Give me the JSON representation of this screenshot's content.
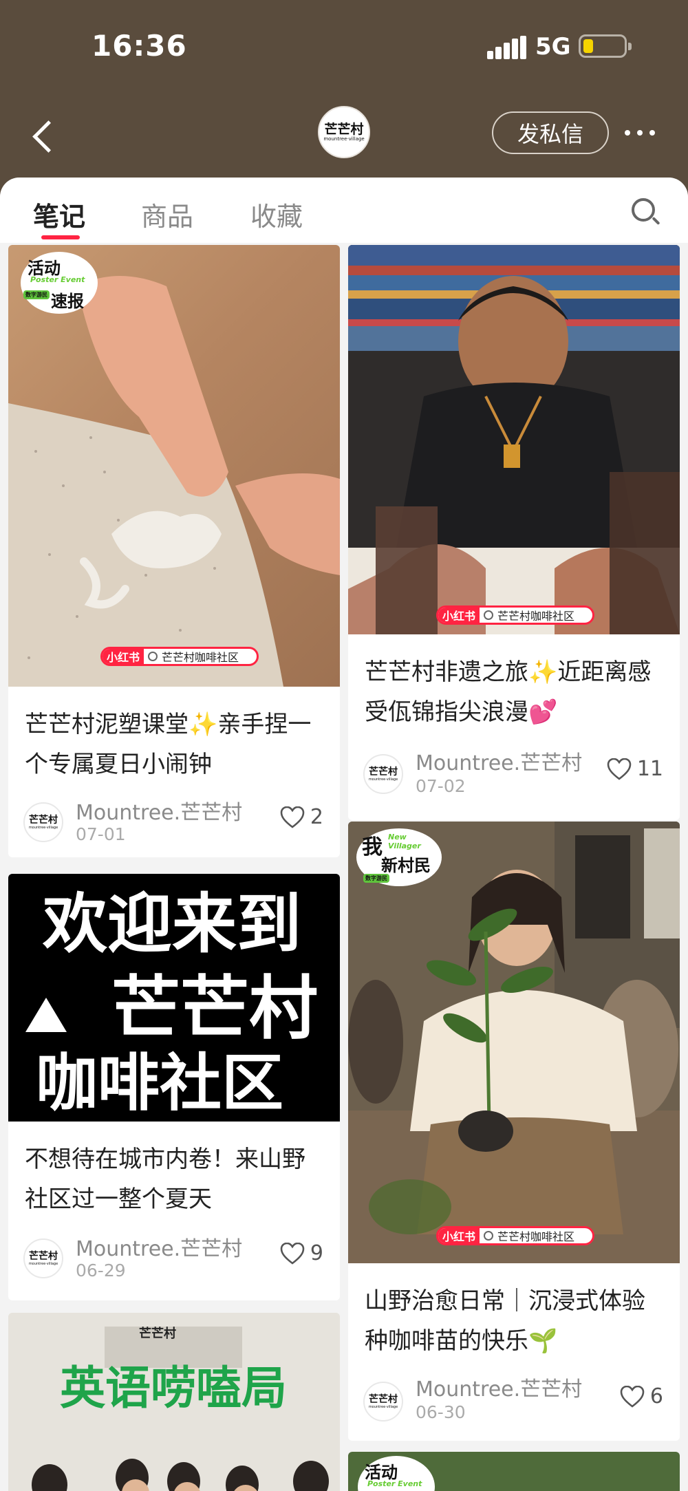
{
  "status": {
    "time": "16:36",
    "network": "5G"
  },
  "nav": {
    "dm_label": "发私信",
    "avatar_logo": "芒芒村",
    "avatar_logo_sub": "mountree·village"
  },
  "tabs": [
    {
      "label": "笔记",
      "active": true
    },
    {
      "label": "商品"
    },
    {
      "label": "收藏"
    }
  ],
  "colors": {
    "accent": "#ff2442",
    "header_bg": "#5a4c3d"
  },
  "sticker_text": {
    "event_title": "活动",
    "event_en": "Poster Event",
    "event_sub": "速报",
    "event_tag": "数字游民",
    "newvillager_title": "我",
    "newvillager_en": "New Villager",
    "newvillager_sub": "新村民"
  },
  "watermark": {
    "brand": "小红书",
    "search": "芒芒村咖啡社区"
  },
  "cards": [
    {
      "title": "芒芒村泥塑课堂✨亲手捏一个专属夏日小闹钟",
      "author": "Mountree.芒芒村",
      "date": "07-01",
      "likes": "2"
    },
    {
      "title": "芒芒村非遗之旅✨近距离感受佤锦指尖浪漫💕",
      "author": "Mountree.芒芒村",
      "date": "07-02",
      "likes": "11"
    },
    {
      "title": "不想待在城市内卷！来山野社区过一整个夏天",
      "author": "Mountree.芒芒村",
      "date": "06-29",
      "likes": "9",
      "image_text": {
        "line1": "欢迎来到",
        "line2": "芒芒村",
        "line3": "咖啡社区"
      }
    },
    {
      "title": "山野治愈日常｜沉浸式体验种咖啡苗的快乐🌱",
      "author": "Mountree.芒芒村",
      "date": "06-30",
      "likes": "6"
    },
    {
      "image_text": {
        "headline": "英语唠嗑局",
        "sign": "芒芒村"
      }
    }
  ],
  "icons": [
    "back-arrow-icon",
    "more-dots-icon",
    "search-icon",
    "heart-icon",
    "signal-icon",
    "battery-icon"
  ]
}
